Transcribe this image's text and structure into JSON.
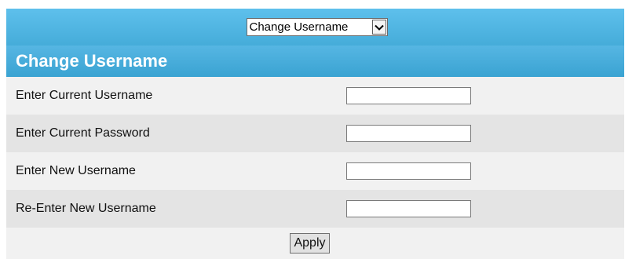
{
  "navigation": {
    "page_select": {
      "selected_value": "Change Username",
      "arrow_icon": "chevron-down-icon"
    }
  },
  "section": {
    "title": "Change Username"
  },
  "form": {
    "fields": [
      {
        "label": "Enter Current Username",
        "value": ""
      },
      {
        "label": "Enter Current Password",
        "value": ""
      },
      {
        "label": "Enter New Username",
        "value": ""
      },
      {
        "label": "Re-Enter New Username",
        "value": ""
      }
    ],
    "apply_label": "Apply"
  },
  "colors": {
    "header_blue": "#45acd9",
    "row_light": "#f1f1f1",
    "row_dark": "#e4e4e4"
  }
}
